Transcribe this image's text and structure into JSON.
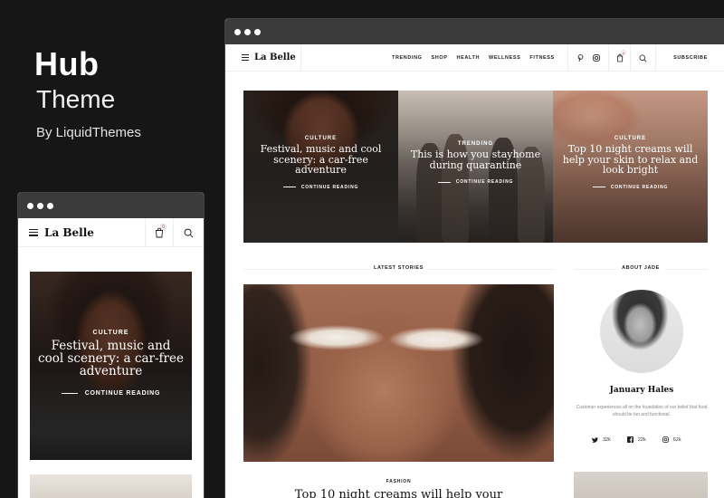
{
  "promo": {
    "title": "Hub",
    "subtitle": "Theme",
    "byline": "By LiquidThemes"
  },
  "site": {
    "logo": "La Belle",
    "nav": [
      "TRENDING",
      "SHOP",
      "HEALTH",
      "WELLNESS",
      "FITNESS"
    ],
    "subscribe": "SUBSCRIBE",
    "cart_count": "0"
  },
  "mobile": {
    "card": {
      "category": "CULTURE",
      "headline": "Festival, music and cool scenery: a car-free adventure",
      "cta": "CONTINUE READING"
    }
  },
  "hero": [
    {
      "category": "CULTURE",
      "headline": "Festival, music and cool scenery: a car-free adventure",
      "cta": "CONTINUE READING"
    },
    {
      "category": "TRENDING",
      "headline": "This is how you stayhome during quarantine",
      "cta": "CONTINUE READING"
    },
    {
      "category": "CULTURE",
      "headline": "Top 10 night creams will help your skin to relax and look bright",
      "cta": "CONTINUE READING"
    }
  ],
  "latest": {
    "title": "LATEST STORIES",
    "category": "FASHION",
    "headline": "Top 10 night creams will help your"
  },
  "about": {
    "title": "ABOUT JADE",
    "name": "January Hales",
    "bio": "Customer experiences all on the foundation of our belief that food should be fun and functional.",
    "socials": [
      {
        "icon": "twitter-icon",
        "count": "32k"
      },
      {
        "icon": "facebook-icon",
        "count": "22k"
      },
      {
        "icon": "instagram-icon",
        "count": "62k"
      }
    ]
  },
  "colors": {
    "background": "#161616",
    "window_bar": "#3b3b3b",
    "badge": "#cc2233"
  }
}
